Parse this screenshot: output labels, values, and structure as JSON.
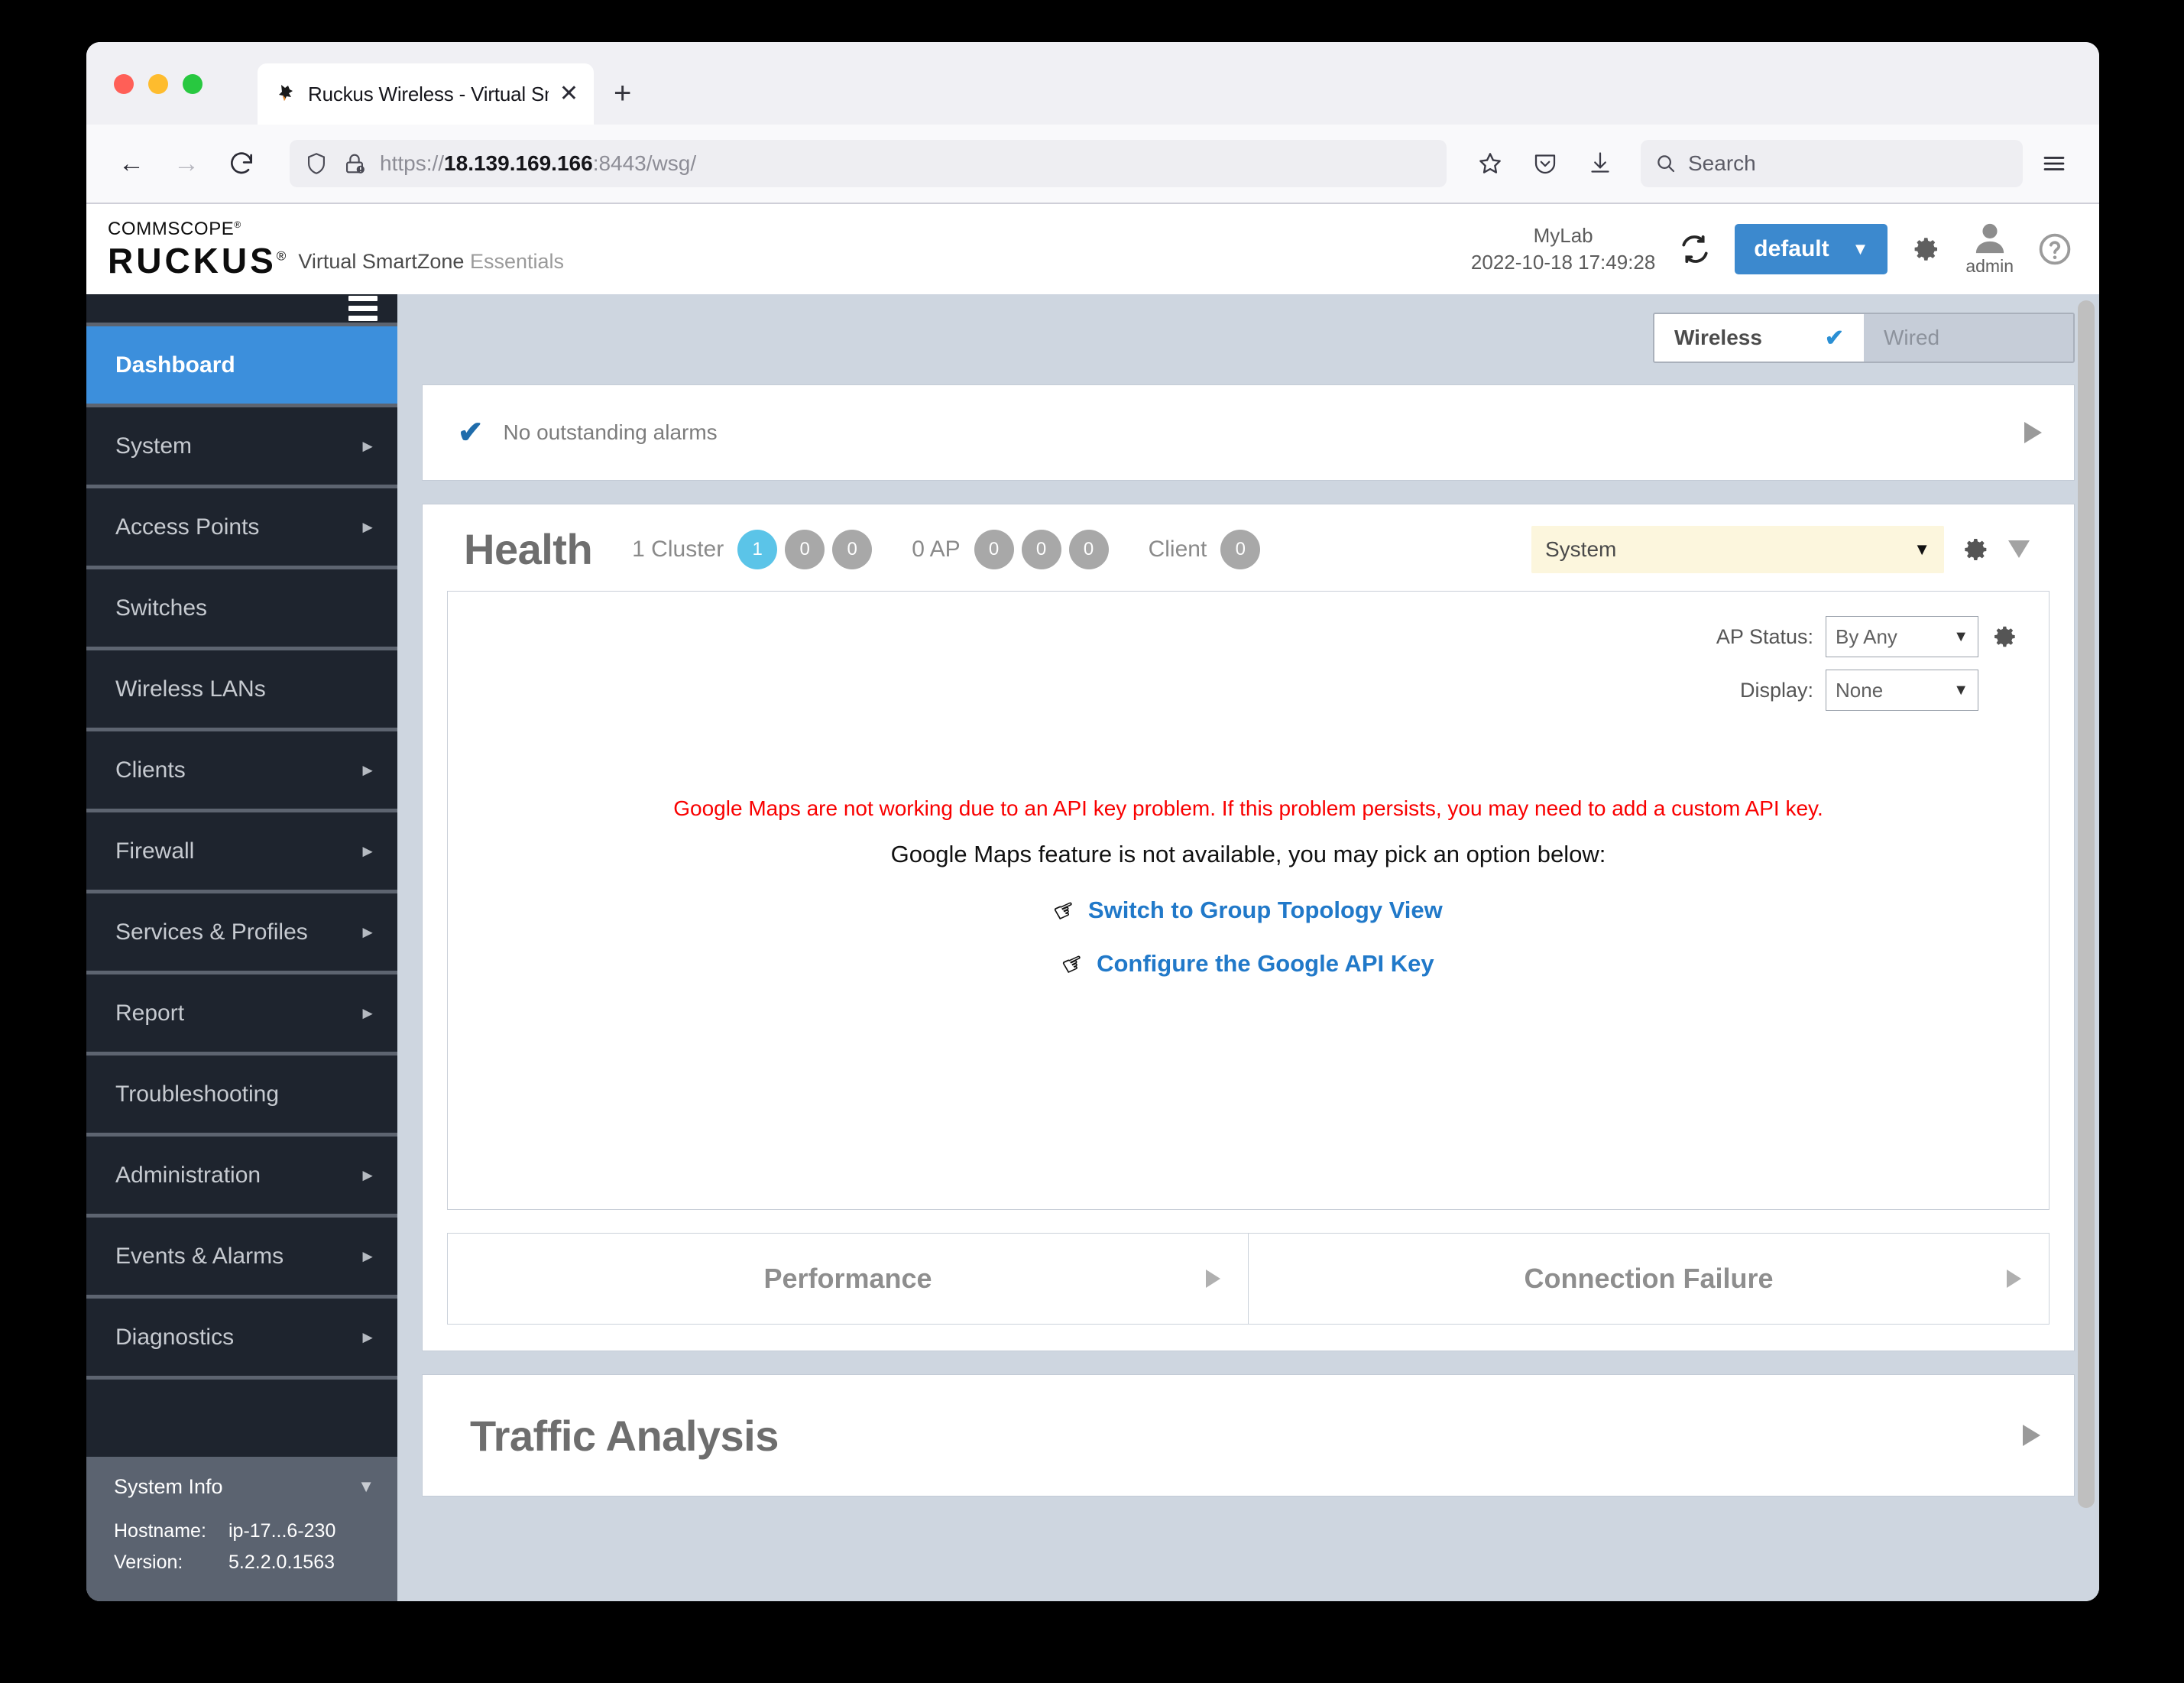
{
  "browser": {
    "tab": {
      "title": "Ruckus Wireless - Virtual SmartZ",
      "close_label": "✕"
    },
    "new_tab_label": "+",
    "back_label": "←",
    "forward_label": "→",
    "reload_label": "⟳",
    "url_prefix": "https://",
    "url_host": "18.139.169.166",
    "url_port": ":8443",
    "url_path": "/wsg/",
    "search_placeholder": "Search",
    "menu_label": "☰"
  },
  "header": {
    "brand_top": "COMMSCOPE",
    "brand_main": "RUCKUS",
    "product_name": "Virtual SmartZone",
    "product_edition": "Essentials",
    "cluster_name": "MyLab",
    "cluster_time": "2022-10-18  17:49:28",
    "domain_label": "default",
    "domain_caret": "▼",
    "user_name": "admin",
    "help_label": "?"
  },
  "sidebar": {
    "items": [
      {
        "label": "Dashboard",
        "arrow": "",
        "active": true
      },
      {
        "label": "System",
        "arrow": "►"
      },
      {
        "label": "Access Points",
        "arrow": "►"
      },
      {
        "label": "Switches",
        "arrow": ""
      },
      {
        "label": "Wireless LANs",
        "arrow": ""
      },
      {
        "label": "Clients",
        "arrow": "►"
      },
      {
        "label": "Firewall",
        "arrow": "►"
      },
      {
        "label": "Services & Profiles",
        "arrow": "►"
      },
      {
        "label": "Report",
        "arrow": "►"
      },
      {
        "label": "Troubleshooting",
        "arrow": ""
      },
      {
        "label": "Administration",
        "arrow": "►"
      },
      {
        "label": "Events & Alarms",
        "arrow": "►"
      },
      {
        "label": "Diagnostics",
        "arrow": "►"
      }
    ],
    "system_info": {
      "title": "System Info",
      "collapse": "▼",
      "hostname_label": "Hostname:",
      "hostname_value": "ip-17...6-230",
      "version_label": "Version:",
      "version_value": "5.2.2.0.1563"
    }
  },
  "content": {
    "mode_tabs": [
      {
        "label": "Wireless",
        "active": true,
        "check": "✔"
      },
      {
        "label": "Wired",
        "active": false,
        "check": ""
      }
    ],
    "alarm": {
      "check": "✔",
      "text": "No outstanding alarms"
    },
    "health": {
      "title": "Health",
      "groups": [
        {
          "label": "1 Cluster",
          "pills": [
            {
              "value": "1",
              "color": "blue"
            },
            {
              "value": "0",
              "color": "gray"
            },
            {
              "value": "0",
              "color": "gray"
            }
          ]
        },
        {
          "label": "0 AP",
          "pills": [
            {
              "value": "0",
              "color": "gray"
            },
            {
              "value": "0",
              "color": "gray"
            },
            {
              "value": "0",
              "color": "gray"
            }
          ]
        },
        {
          "label": "Client",
          "pills": [
            {
              "value": "0",
              "color": "gray"
            }
          ]
        }
      ],
      "scope_select": "System",
      "scope_caret": "▼",
      "ap_status_label": "AP Status:",
      "ap_status_value": "By Any",
      "display_label": "Display:",
      "display_value": "None",
      "caret": "▼",
      "map_error": "Google Maps are not working due to an API key problem. If this problem persists, you may need to add a custom API key.",
      "map_subtext": "Google Maps feature is not available, you may pick an option below:",
      "link_topology": "Switch to Group Topology View",
      "link_apikey": "Configure the Google API Key",
      "hand_icon": "☞"
    },
    "performance_title": "Performance",
    "connection_failure_title": "Connection Failure",
    "traffic_analysis_title": "Traffic Analysis"
  },
  "colors": {
    "accent_blue": "#3c89ce",
    "sidebar_active": "#3c8fdc",
    "error_red": "#f90000",
    "link_blue": "#2179c9",
    "pill_blue": "#5bc4e8",
    "select_cream": "#fcf6dd"
  }
}
